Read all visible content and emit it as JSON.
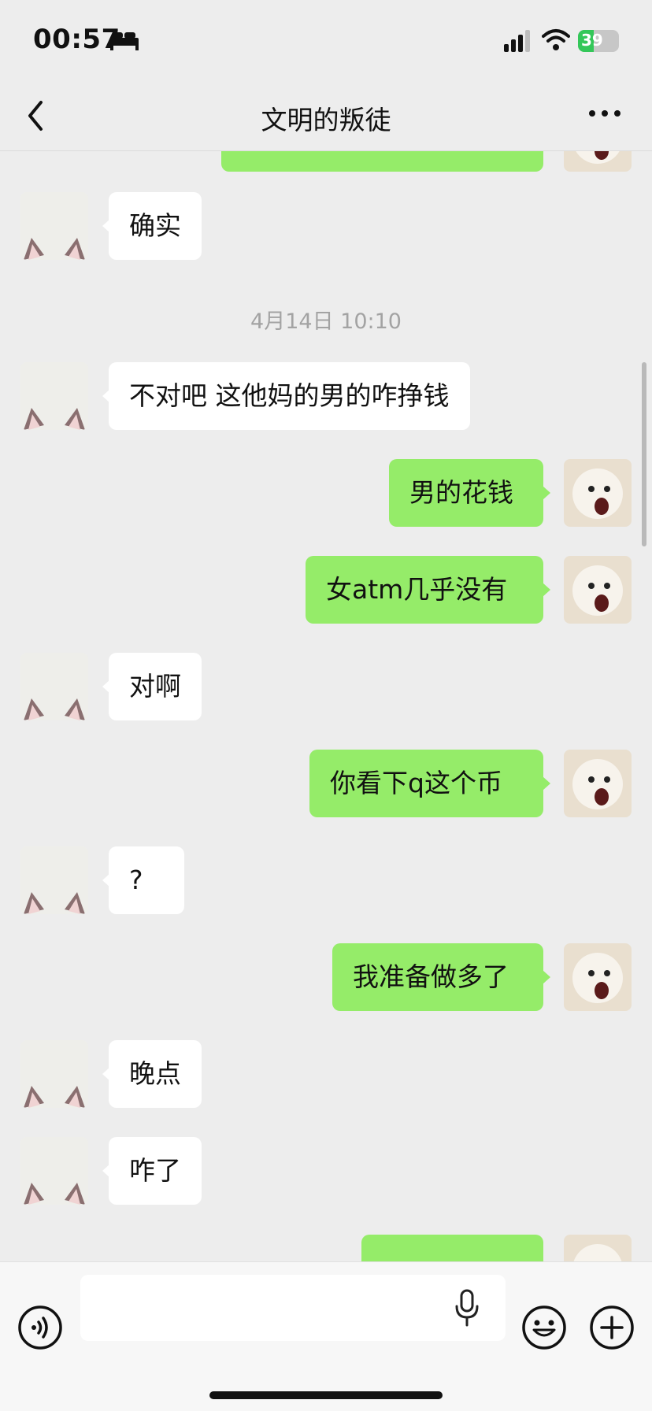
{
  "status_bar": {
    "time": "00:57",
    "battery_percent": "39",
    "battery_level": 0.39
  },
  "header": {
    "title": "文明的叛徒"
  },
  "messages": [
    {
      "side": "left",
      "text": "确实"
    },
    {
      "type": "time",
      "text": "4月14日 10:10"
    },
    {
      "side": "left",
      "text": "不对吧 这他妈的男的咋挣钱"
    },
    {
      "side": "right",
      "text": "男的花钱"
    },
    {
      "side": "right",
      "text": "女atm几乎没有"
    },
    {
      "side": "left",
      "text": "对啊"
    },
    {
      "side": "right",
      "text": "你看下q这个币"
    },
    {
      "side": "left",
      "text": "?"
    },
    {
      "side": "right",
      "text": "我准备做多了"
    },
    {
      "side": "left",
      "text": "晚点"
    },
    {
      "side": "left",
      "text": "咋了"
    }
  ],
  "input": {
    "placeholder": ""
  },
  "colors": {
    "background": "#ededed",
    "outgoing_bubble": "#95ec69",
    "incoming_bubble": "#ffffff",
    "battery": "#34c759"
  },
  "icons": [
    "bed-icon",
    "signal-icon",
    "wifi-icon",
    "back-icon",
    "more-icon",
    "voice-icon",
    "mic-icon",
    "emoji-icon",
    "plus-icon"
  ]
}
